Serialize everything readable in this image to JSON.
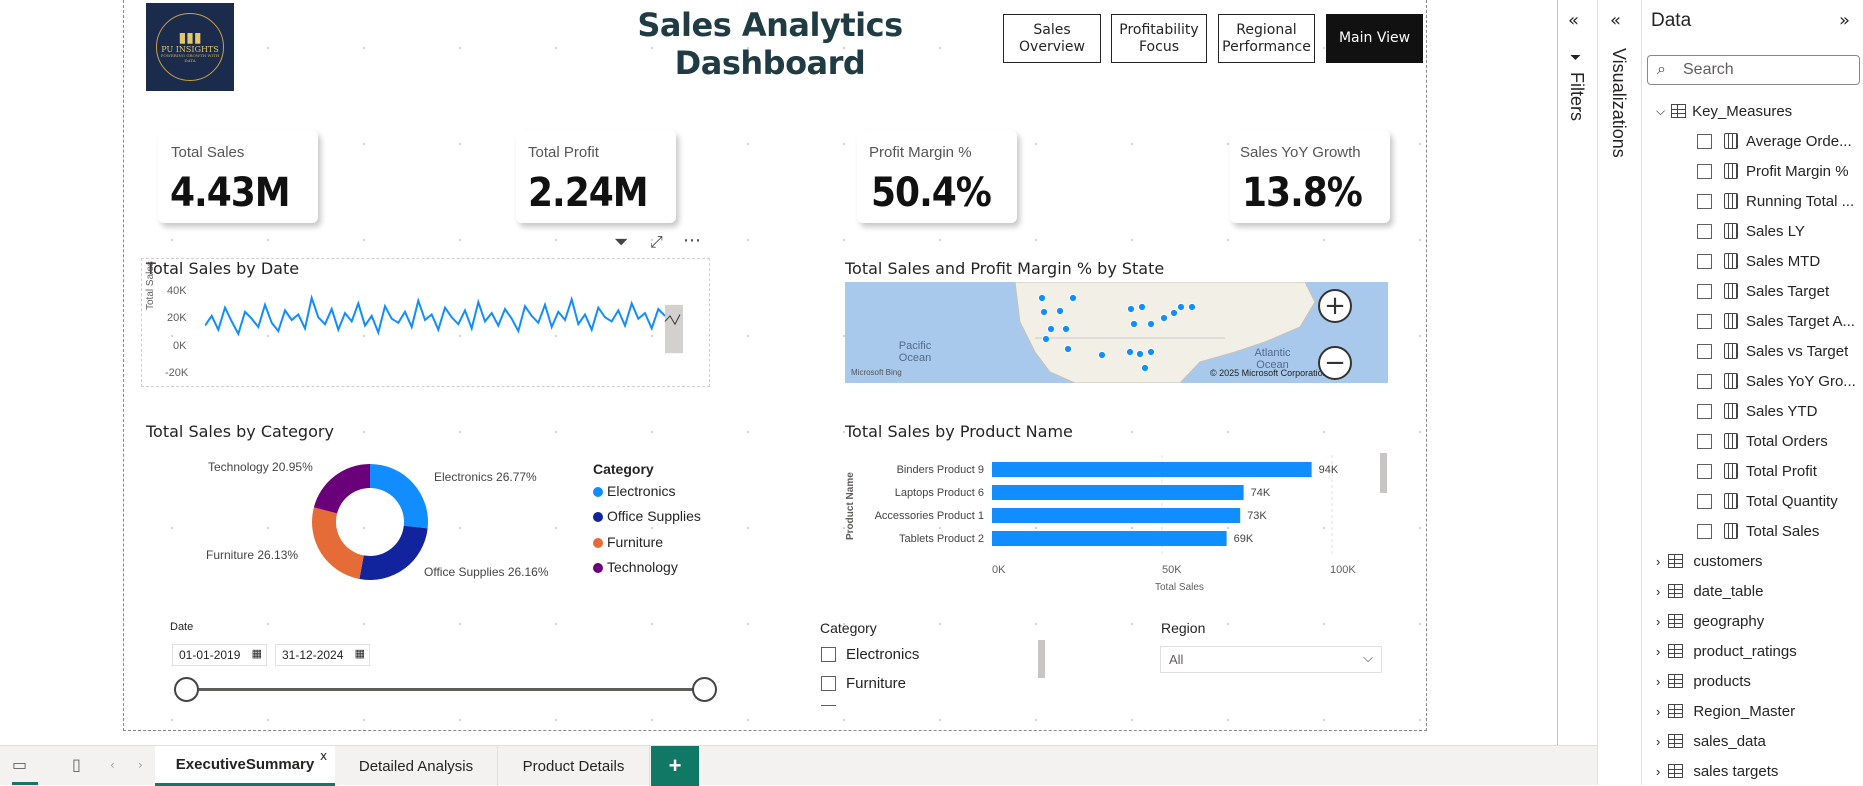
{
  "logo": {
    "line1": "PU INSIGHTS",
    "line2": "POWERING GROWTH WITH DATA"
  },
  "header": {
    "title": "Sales Analytics Dashboard"
  },
  "nav": [
    {
      "label": "Sales Overview"
    },
    {
      "label": "Profitability Focus"
    },
    {
      "label": "Regional Performance"
    },
    {
      "label": "Main View"
    }
  ],
  "kpis": [
    {
      "label": "Total Sales",
      "value": "4.43M"
    },
    {
      "label": "Total Profit",
      "value": "2.24M"
    },
    {
      "label": "Profit Margin %",
      "value": "50.4%"
    },
    {
      "label": "Sales YoY Growth",
      "value": "13.8%"
    }
  ],
  "visual_header_icons": [
    "filter-icon",
    "focus-mode-icon",
    "more-options-icon"
  ],
  "line_chart": {
    "title": "Total Sales by Date",
    "ylabel": "Total Sales",
    "yticks": [
      "40K",
      "20K",
      "0K",
      "-20K"
    ]
  },
  "map": {
    "title": "Total Sales and Profit Margin % by State",
    "labels": {
      "pacific": "Pacific Ocean",
      "atlantic": "Atlantic Ocean",
      "copyright": "© 2025 Microsoft Corporation",
      "bing": "Microsoft Bing"
    }
  },
  "donut": {
    "title": "Total Sales by Category",
    "legend_title": "Category",
    "slice_labels": [
      "Electronics 26.77%",
      "Office Supplies 26.16%",
      "Furniture 26.13%",
      "Technology 20.95%"
    ]
  },
  "bar_chart_meta": {
    "title": "Total Sales by Product Name",
    "ylabel": "Product Name",
    "xlabel": "Total Sales",
    "xticks": [
      "0K",
      "50K",
      "100K"
    ]
  },
  "date_slicer": {
    "label": "Date",
    "start": "01-01-2019",
    "end": "31-12-2024"
  },
  "category_slicer": {
    "label": "Category",
    "items": [
      "Electronics",
      "Furniture"
    ]
  },
  "region_slicer": {
    "label": "Region",
    "value": "All"
  },
  "chart_data": [
    {
      "type": "line",
      "title": "Total Sales by Date",
      "xlabel": "",
      "ylabel": "Total Sales",
      "ylim": [
        -20000,
        40000
      ],
      "series": [
        {
          "name": "Total Sales",
          "values": [
            15000,
            22000,
            12000,
            28000,
            18000,
            9000,
            25000,
            20000,
            14000,
            30000,
            17000,
            11000,
            26000,
            19000,
            23000,
            13000,
            35000,
            21000,
            16000,
            27000,
            12000,
            24000,
            18000,
            31000,
            15000,
            22000,
            10000,
            29000,
            20000,
            17000,
            25000,
            14000,
            33000,
            19000,
            23000,
            12000,
            28000,
            21000,
            16000,
            26000,
            13000,
            32000,
            18000,
            24000,
            15000,
            27000,
            20000,
            11000,
            29000,
            22000,
            17000,
            30000,
            14000,
            25000,
            19000,
            34000,
            16000,
            23000,
            12000,
            28000,
            21000,
            18000,
            26000,
            15000,
            31000,
            20000,
            24000,
            13000,
            27000,
            22000
          ]
        }
      ],
      "grid": false
    },
    {
      "type": "pie",
      "title": "Total Sales by Category",
      "categories": [
        "Electronics",
        "Office Supplies",
        "Furniture",
        "Technology"
      ],
      "values": [
        26.77,
        26.16,
        26.13,
        20.95
      ],
      "colors": [
        "#118DFF",
        "#12239E",
        "#E66C37",
        "#6B007B"
      ],
      "legend": "right"
    },
    {
      "type": "bar",
      "title": "Total Sales by Product Name",
      "categories": [
        "Binders Product 9",
        "Laptops Product 6",
        "Accessories Product 1",
        "Tablets Product 2"
      ],
      "values": [
        94000,
        74000,
        73000,
        69000
      ],
      "labels": [
        "94K",
        "74K",
        "73K",
        "69K"
      ],
      "xlabel": "Total Sales",
      "ylabel": "Product Name",
      "xlim": [
        0,
        100000
      ],
      "color": "#118DFF"
    }
  ],
  "filters_pane": {
    "label": "Filters"
  },
  "viz_pane": {
    "label": "Visualizations"
  },
  "data_pane": {
    "title": "Data",
    "search_placeholder": "Search",
    "measures_table": "Key_Measures",
    "measures": [
      "Average Orde...",
      "Profit Margin %",
      "Running Total ...",
      "Sales LY",
      "Sales MTD",
      "Sales Target",
      "Sales Target A...",
      "Sales vs Target",
      "Sales YoY Gro...",
      "Sales YTD",
      "Total Orders",
      "Total Profit",
      "Total Quantity",
      "Total Sales"
    ],
    "tables": [
      "customers",
      "date_table",
      "geography",
      "product_ratings",
      "products",
      "Region_Master",
      "sales_data",
      "sales targets"
    ]
  },
  "tabs": [
    {
      "label": "ExecutiveSummary",
      "close": "x"
    },
    {
      "label": "Detailed Analysis"
    },
    {
      "label": "Product Details"
    }
  ],
  "add_tab_label": "+",
  "colors": {
    "accent_tab": "#117865",
    "add_button": "#117865",
    "series": "#118DFF"
  }
}
